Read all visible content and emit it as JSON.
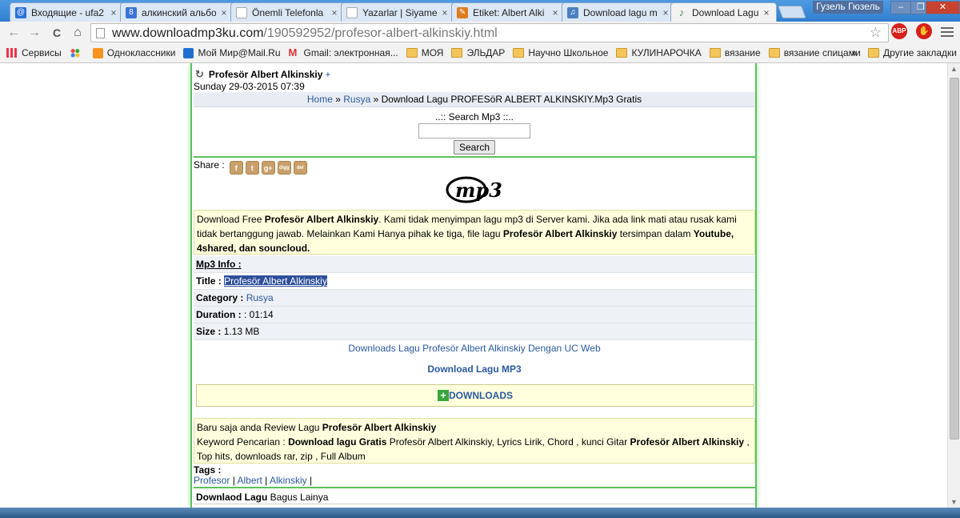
{
  "browser": {
    "tabs": [
      {
        "title": "Входящие - ufa2",
        "icon": "mail-icon",
        "color": "#2a6fd6"
      },
      {
        "title": "алкинский альбо",
        "icon": "google-icon",
        "color": "#3b73d8"
      },
      {
        "title": "Önemli Telefonla",
        "icon": "page-icon",
        "color": "#ffffff"
      },
      {
        "title": "Yazarlar | Siyame",
        "icon": "page-icon",
        "color": "#ffffff"
      },
      {
        "title": "Etiket: Albert Alki",
        "icon": "tag-icon",
        "color": "#e07b1c"
      },
      {
        "title": "Download lagu m",
        "icon": "music-icon",
        "color": "#4a7fc0"
      },
      {
        "title": "Download Lagu P",
        "icon": "music-note-icon",
        "color": "#3a8a3a"
      }
    ],
    "tab_close": "×",
    "user_name": "Гузель Гюзель",
    "window_controls": {
      "minimize": "‒",
      "maximize": "❐",
      "close": "✕"
    },
    "nav": {
      "back": "←",
      "forward": "→",
      "reload": "C",
      "home": "⌂"
    },
    "url_host": "www.downloadmp3ku.com",
    "url_path": "/190592952/profesor-albert-alkinskiy.html",
    "star": "☆",
    "abp": "ABP",
    "bookmarks": [
      {
        "label": "Сервисы",
        "icon": "apps-icon"
      },
      {
        "label": "",
        "icon": "dots-icon"
      },
      {
        "label": "Одноклассники",
        "icon": "ok-icon"
      },
      {
        "label": "Мой Мир@Mail.Ru",
        "icon": "mailru-icon"
      },
      {
        "label": "Gmail: электронная...",
        "icon": "gmail-icon"
      },
      {
        "label": "МОЯ",
        "icon": "folder-icon"
      },
      {
        "label": "ЭЛЬДАР",
        "icon": "folder-icon"
      },
      {
        "label": "Научно Школьное",
        "icon": "folder-icon"
      },
      {
        "label": "КУЛИНАРОЧКА",
        "icon": "folder-icon"
      },
      {
        "label": "вязание",
        "icon": "folder-icon"
      },
      {
        "label": "вязание спицами",
        "icon": "folder-icon"
      }
    ],
    "bookmarks_more": "»",
    "bookmarks_other": "Другие закладки"
  },
  "page": {
    "title": "Profesör Albert Alkinskiy",
    "title_plus": "+",
    "date": "Sunday 29-03-2015 07:39",
    "breadcrumb": {
      "home": "Home",
      "sep1": " » ",
      "category": "Rusya",
      "sep2": " » ",
      "current": "Download Lagu PROFESöR ALBERT ALKINSKIY.Mp3 Gratis"
    },
    "search": {
      "label": "..:: Search Mp3 ::..",
      "button": "Search",
      "placeholder": ""
    },
    "share": {
      "label": "Share :",
      "icons": [
        "f",
        "t",
        "g+",
        "digg",
        "del"
      ]
    },
    "logo_text": "mp3",
    "notice": {
      "p1": "Download Free ",
      "b1": "Profesör Albert Alkinskiy",
      "p2": ". Kami tidak menyimpan lagu mp3 di Server kami. Jika ada link mati atau rusak kami tidak bertanggung jawab. Melainkan Kami Hanya pihak ke tiga, file lagu ",
      "b2": "Profesör Albert Alkinskiy",
      "p3": " tersimpan dalam ",
      "b3": "Youtube, 4shared, dan souncloud."
    },
    "info": {
      "heading": "Mp3 Info :",
      "title_label": "Title :",
      "title_value": "Profesör Albert Alkinskiy",
      "category_label": "Category :",
      "category_value": "Rusya",
      "duration_label": "Duration :",
      "duration_value": ": 01:14",
      "size_label": "Size :",
      "size_value": "1.13 MB"
    },
    "download_uc": "Downloads Lagu Profesör Albert Alkinskiy Dengan UC Web",
    "download_mp3": "Download Lagu MP3",
    "downloads_button": "DOWNLOADS",
    "review": {
      "p1": "Baru saja anda Review Lagu ",
      "b1": "Profesör Albert Alkinskiy",
      "p2": "Keyword Pencarian : ",
      "b2": "Download lagu Gratis",
      "p3": " Profesör Albert Alkinskiy, Lyrics Lirik, Chord , kunci Gitar ",
      "b3": "Profesör Albert Alkinskiy",
      "p4": " , Top hits, downloads rar, zip , Full Album"
    },
    "tags": {
      "label": "Tags :",
      "items": [
        "Profesor",
        "Albert",
        "Alkinskiy"
      ],
      "sep": " | ",
      "trail": " |"
    },
    "related": {
      "b": "Downlaod Lagu",
      "rest": " Bagus Lainya"
    }
  }
}
